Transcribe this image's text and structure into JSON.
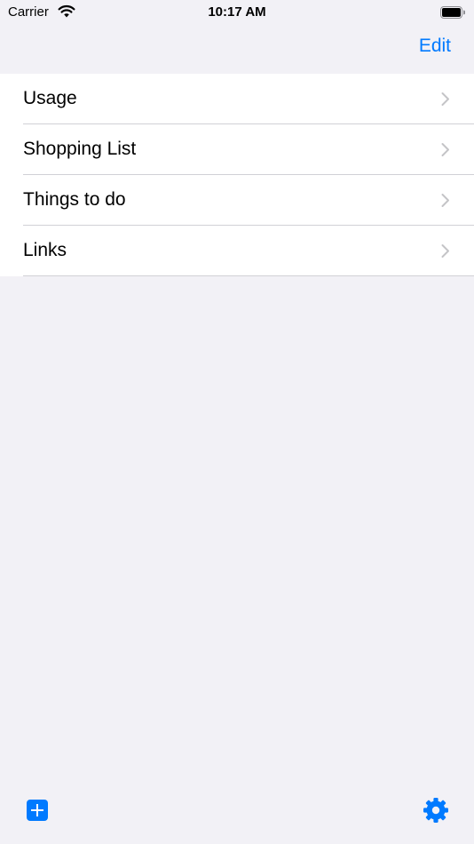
{
  "status_bar": {
    "carrier": "Carrier",
    "time": "10:17 AM",
    "icons": [
      "wifi-icon",
      "battery-icon"
    ]
  },
  "nav": {
    "edit_label": "Edit"
  },
  "lists": [
    {
      "label": "Usage"
    },
    {
      "label": "Shopping List"
    },
    {
      "label": "Things to do"
    },
    {
      "label": "Links"
    }
  ],
  "toolbar": {
    "icons": [
      "plus-icon",
      "gear-icon"
    ]
  },
  "colors": {
    "accent": "#007aff",
    "background": "#f2f1f6",
    "cell": "#ffffff",
    "separator": "#d1d1d6",
    "chevron": "#c4c4c7"
  }
}
